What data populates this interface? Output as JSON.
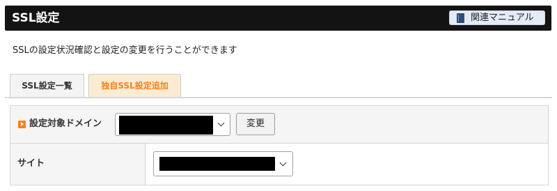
{
  "header": {
    "title": "SSL設定",
    "manual_button_label": "関連マニュアル",
    "manual_icon": "book-icon"
  },
  "description": "SSLの設定状況確認と設定の変更を行うことができます",
  "tabs": [
    {
      "label": "SSL設定一覧",
      "active": false
    },
    {
      "label": "独自SSL設定追加",
      "active": true
    }
  ],
  "form": {
    "domain_label": "設定対象ドメイン",
    "domain_icon": "orange-arrow-icon",
    "domain_select_value": "",
    "change_button_label": "変更",
    "site_label": "サイト",
    "site_select_value": ""
  },
  "colors": {
    "header_bg": "#131313",
    "active_tab_text": "#f5821f",
    "active_tab_bg": "#fcebd3",
    "accent_orange": "#f5821f"
  }
}
